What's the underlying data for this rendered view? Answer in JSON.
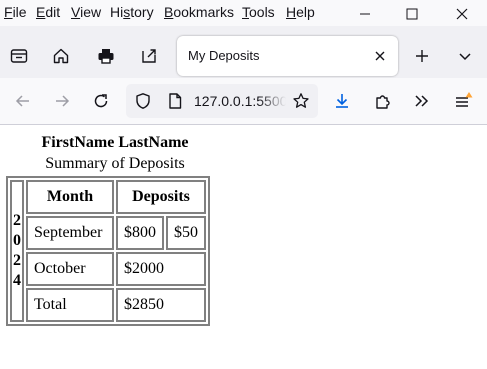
{
  "menubar": {
    "items": [
      {
        "label": "File"
      },
      {
        "label": "Edit"
      },
      {
        "label": "View"
      },
      {
        "label": "History"
      },
      {
        "label": "Bookmarks"
      },
      {
        "label": "Tools"
      },
      {
        "label": "Help"
      }
    ]
  },
  "tab": {
    "title": "My Deposits"
  },
  "urlbar": {
    "url": "127.0.0.1:5500"
  },
  "page": {
    "name": "FirstName LastName",
    "subtitle": "Summary of Deposits",
    "year_digits": [
      "2",
      "0",
      "2",
      "4"
    ],
    "headers": {
      "month": "Month",
      "deposits": "Deposits"
    },
    "rows": [
      {
        "month": "September",
        "deposits": [
          "$800",
          "$50"
        ]
      },
      {
        "month": "October",
        "deposits": [
          "$2000"
        ]
      },
      {
        "month": "Total",
        "deposits": [
          "$2850"
        ]
      }
    ]
  },
  "colors": {
    "accent": "#0061e0",
    "notification": "#ffa436",
    "table_border": "#808080"
  }
}
